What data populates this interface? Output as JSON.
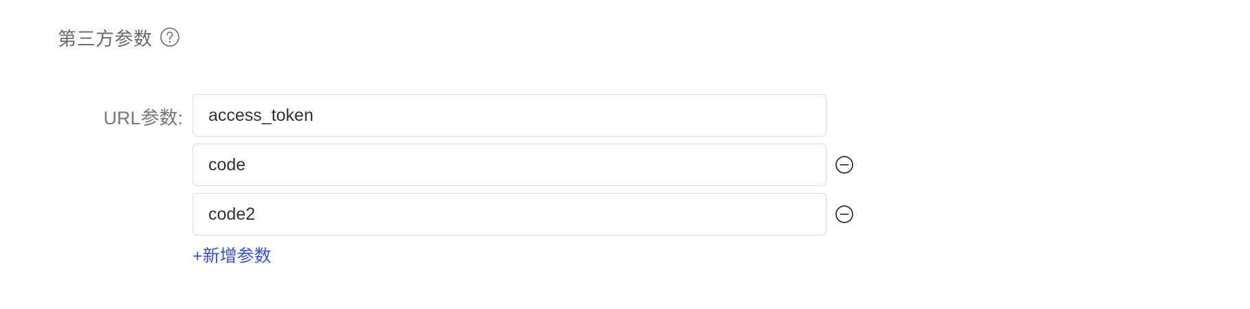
{
  "section": {
    "title": "第三方参数",
    "help_icon": "question-circle-icon"
  },
  "form": {
    "label": "URL参数:",
    "params": [
      {
        "value": "access_token",
        "removable": false
      },
      {
        "value": "code",
        "removable": true
      },
      {
        "value": "code2",
        "removable": true
      }
    ],
    "remove_icon": "minus-circle-icon",
    "add_label": "+新增参数"
  },
  "colors": {
    "title_text": "#6b6b6b",
    "label_text": "#777777",
    "input_border": "#d9d9d9",
    "link": "#3b4fd8"
  }
}
